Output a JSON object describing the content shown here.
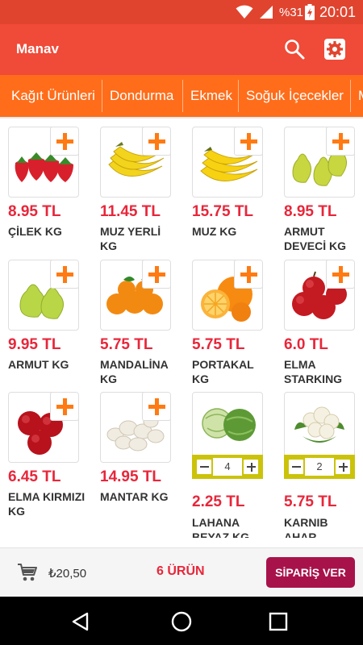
{
  "status_bar": {
    "battery_pct": "%31",
    "time": "20:01"
  },
  "app_bar": {
    "title": "Manav",
    "search_icon": "search-icon",
    "settings_icon": "gear-icon"
  },
  "colors": {
    "app_bar": "#f04a38",
    "status_bar": "#e0442f",
    "tabs": "#ff6d1a",
    "price": "#e8263a",
    "add": "#ff7a12",
    "stepper": "#cbc30a",
    "order_button": "#a8124a"
  },
  "tabs": [
    {
      "label": "Kağıt Ürünleri"
    },
    {
      "label": "Dondurma"
    },
    {
      "label": "Ekmek"
    },
    {
      "label": "Soğuk İçecekler"
    },
    {
      "label": "M"
    }
  ],
  "products": [
    {
      "price": "8.95 TL",
      "name": "ÇİLEK KG",
      "image": "strawberries"
    },
    {
      "price": "11.45 TL",
      "name": "MUZ YERLİ KG",
      "image": "bananas"
    },
    {
      "price": "15.75 TL",
      "name": "MUZ KG",
      "image": "bananas"
    },
    {
      "price": "8.95 TL",
      "name": "ARMUT DEVECİ KG",
      "image": "pears"
    },
    {
      "price": "9.95 TL",
      "name": "ARMUT KG",
      "image": "pears"
    },
    {
      "price": "5.75 TL",
      "name": "MANDALİNA KG",
      "image": "tangerines"
    },
    {
      "price": "5.75 TL",
      "name": "PORTAKAL KG",
      "image": "oranges"
    },
    {
      "price": "6.0 TL",
      "name": "ELMA STARKING",
      "image": "red-apples"
    },
    {
      "price": "6.45 TL",
      "name": "ELMA KIRMIZI KG",
      "image": "red-apples"
    },
    {
      "price": "14.95 TL",
      "name": "MANTAR KG",
      "image": "mushrooms"
    },
    {
      "price": "2.25 TL",
      "name": "LAHANA BEYAZ KG",
      "image": "cabbage",
      "quantity": "4"
    },
    {
      "price": "5.75 TL",
      "name": "KARNIB AHAR",
      "image": "cauliflower",
      "quantity": "2"
    }
  ],
  "cart": {
    "total": "₺20,50",
    "count_label": "6 ÜRÜN",
    "order_label": "SİPARİŞ VER",
    "icon": "cart-icon"
  },
  "nav": {
    "back_icon": "back-icon",
    "home_icon": "home-icon",
    "recents_icon": "recents-icon"
  }
}
